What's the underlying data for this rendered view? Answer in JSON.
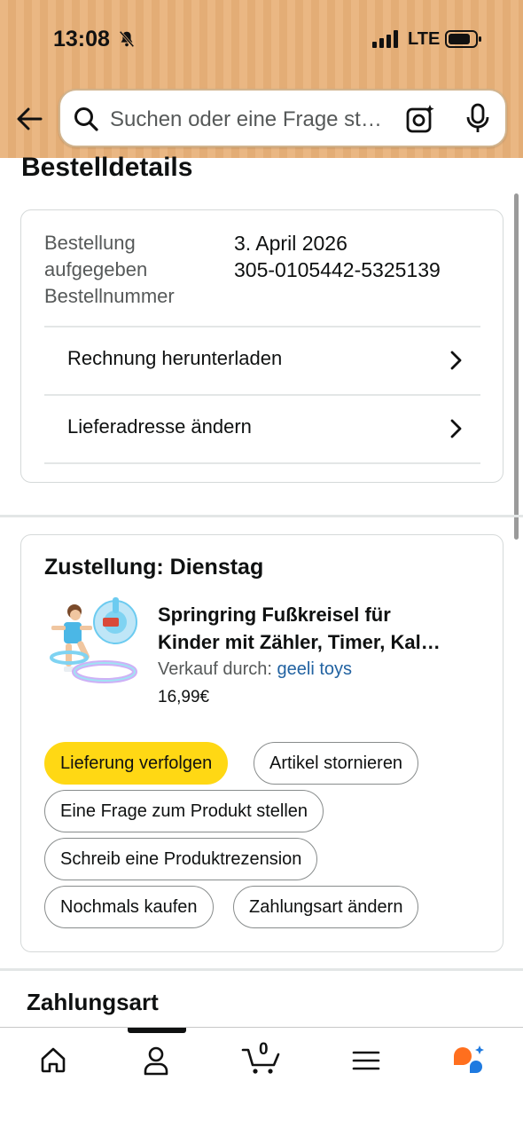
{
  "status_bar": {
    "time": "13:08",
    "network": "LTE"
  },
  "search": {
    "placeholder": "Suchen oder eine Frage st…"
  },
  "page": {
    "title": "Bestelldetails"
  },
  "order_info": {
    "label_line1": "Bestellung",
    "label_line2": "aufgegeben",
    "label_line3": "Bestellnummer",
    "date": "3. April 2026",
    "order_number": "305-0105442-5325139",
    "links": [
      {
        "label": "Rechnung herunterladen"
      },
      {
        "label": "Lieferadresse ändern"
      }
    ]
  },
  "delivery": {
    "title": "Zustellung: Dienstag",
    "product": {
      "title_line1": "Springring Fußkreisel für",
      "title_line2": "Kinder mit Zähler, Timer, Kal…",
      "seller_prefix": "Verkauf durch: ",
      "seller_name": "geeli toys",
      "price": "16,99€"
    },
    "actions": {
      "track": "Lieferung verfolgen",
      "cancel": "Artikel stornieren",
      "question": "Eine Frage zum Produkt stellen",
      "review": "Schreib eine Produktrezension",
      "buy_again": "Nochmals kaufen",
      "change_payment": "Zahlungsart ändern"
    }
  },
  "payment": {
    "heading": "Zahlungsart"
  },
  "bottom_nav": {
    "cart_count": "0"
  },
  "icons": {
    "back": "back-arrow-icon",
    "search": "search-icon",
    "camera": "camera-lens-icon",
    "mic": "microphone-icon",
    "home": "home-icon",
    "account": "account-icon",
    "cart": "cart-icon",
    "menu": "menu-icon",
    "rufus": "rufus-assistant-icon"
  },
  "colors": {
    "header_bg": "#eab783",
    "primary_button": "#ffd814",
    "link": "#2162a1",
    "rufus_orange": "#ff6f1e",
    "rufus_blue": "#1f7ae0"
  }
}
